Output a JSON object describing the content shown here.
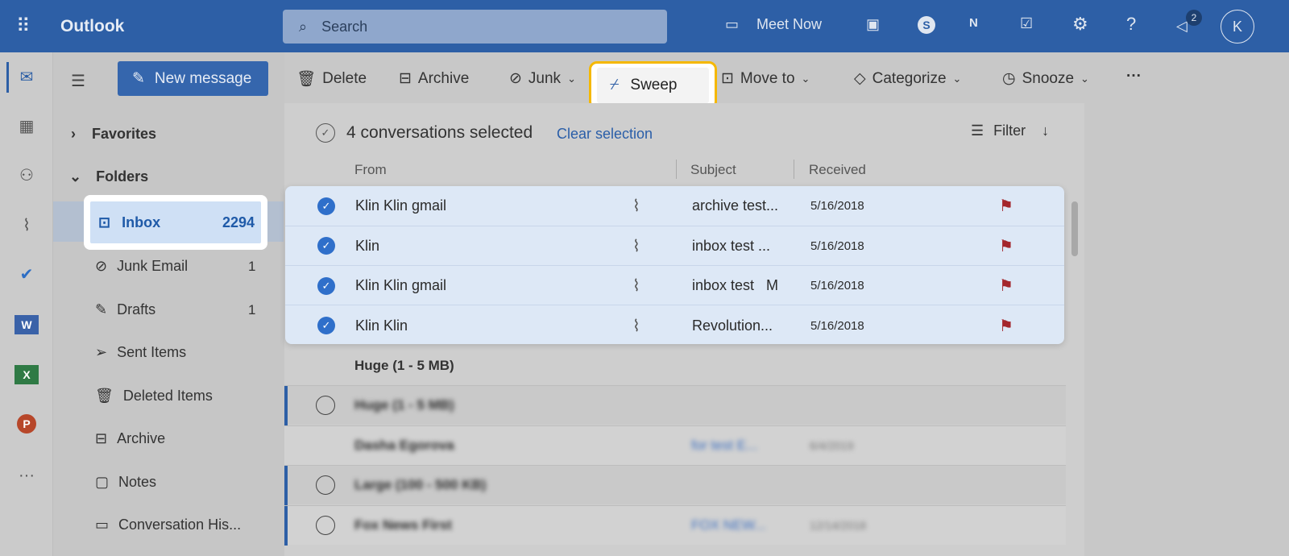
{
  "app": {
    "title": "Outlook",
    "search_placeholder": "Search",
    "meet_now": "Meet Now",
    "notification_count": "2",
    "avatar_initial": "K",
    "icons": [
      "waffle-icon",
      "video-icon",
      "qr-code-icon",
      "skype-icon",
      "onenote-icon",
      "calendar-check-icon",
      "gear-icon",
      "help-icon",
      "megaphone-icon"
    ]
  },
  "toolbar": {
    "new_message": "New message",
    "delete": "Delete",
    "archive": "Archive",
    "junk": "Junk",
    "sweep": "Sweep",
    "move_to": "Move to",
    "categorize": "Categorize",
    "snooze": "Snooze",
    "more": "···"
  },
  "folders": {
    "favorites": "Favorites",
    "folders": "Folders",
    "items": [
      {
        "label": "Inbox",
        "count": "2294"
      },
      {
        "label": "Junk Email",
        "count": "1"
      },
      {
        "label": "Drafts",
        "count": "1"
      },
      {
        "label": "Sent Items",
        "count": ""
      },
      {
        "label": "Deleted Items",
        "count": ""
      },
      {
        "label": "Archive",
        "count": ""
      },
      {
        "label": "Notes",
        "count": ""
      },
      {
        "label": "Conversation His...",
        "count": ""
      }
    ]
  },
  "list": {
    "selection_text": "4 conversations selected",
    "clear_selection": "Clear selection",
    "filter": "Filter",
    "columns": {
      "from": "From",
      "subject": "Subject",
      "received": "Received"
    },
    "selected_rows": [
      {
        "from": "Klin Klin gmail",
        "subject": "archive test...",
        "received": "5/16/2018"
      },
      {
        "from": "Klin",
        "subject": "inbox test ...",
        "received": "5/16/2018"
      },
      {
        "from": "Klin Klin gmail",
        "subject": "inbox test   M",
        "received": "5/16/2018"
      },
      {
        "from": "Klin Klin",
        "subject": "Revolution...",
        "received": "5/16/2018"
      }
    ],
    "group_header": "Huge (1 - 5 MB)",
    "blurred_rows": [
      {
        "from": "Huge (1 - 5 MB)",
        "subject": "",
        "received": ""
      },
      {
        "from": "Dasha Egorova",
        "subject": "for test E...",
        "received": "6/4/2019"
      },
      {
        "from": "Large (100 - 500 KB)",
        "subject": "",
        "received": ""
      },
      {
        "from": "Fox News First",
        "subject": "FOX NEW...",
        "received": "12/14/2018"
      }
    ]
  },
  "colors": {
    "brand": "#2d5fa6",
    "highlight": "#f5b800",
    "flag": "#a4262c",
    "accent": "#2f6fca"
  }
}
